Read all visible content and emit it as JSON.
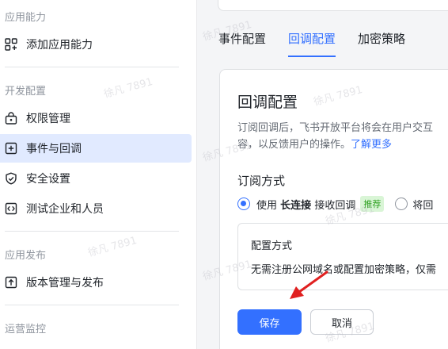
{
  "sidebar": {
    "sections": [
      {
        "title": "应用能力",
        "items": [
          {
            "label": "添加应用能力",
            "icon": "grid-add-icon"
          }
        ]
      },
      {
        "title": "开发配置",
        "items": [
          {
            "label": "权限管理",
            "icon": "lock-icon"
          },
          {
            "label": "事件与回调",
            "icon": "event-plus-icon",
            "active": true
          },
          {
            "label": "安全设置",
            "icon": "shield-icon"
          },
          {
            "label": "测试企业和人员",
            "icon": "code-box-icon"
          }
        ]
      },
      {
        "title": "应用发布",
        "items": [
          {
            "label": "版本管理与发布",
            "icon": "upload-box-icon"
          }
        ]
      },
      {
        "title": "运营监控",
        "items": []
      }
    ]
  },
  "main": {
    "tabs": [
      "事件配置",
      "回调配置",
      "加密策略"
    ],
    "active_tab": "回调配置",
    "card": {
      "title": "回调配置",
      "description_line1": "订阅回调后，飞书开放平台将会在用户交互",
      "description_line2": "容，以反馈用户的操作。",
      "learn_more": "了解更多",
      "subscribe_title": "订阅方式",
      "option1_prefix": "使用",
      "option1_bold": "长连接",
      "option1_suffix": "接收回调",
      "option1_tag": "推荐",
      "option2_label": "将回",
      "config_box_title": "配置方式",
      "config_box_text": "无需注册公网域名或配置加密策略，仅需",
      "save_label": "保存",
      "cancel_label": "取消"
    }
  },
  "watermark": "徐凡 7891",
  "colors": {
    "accent": "#3370ff",
    "active_bg": "#e1eaff",
    "tag_text": "#2ea121",
    "tag_bg": "#d9f5d6",
    "arrow": "#e02020"
  }
}
